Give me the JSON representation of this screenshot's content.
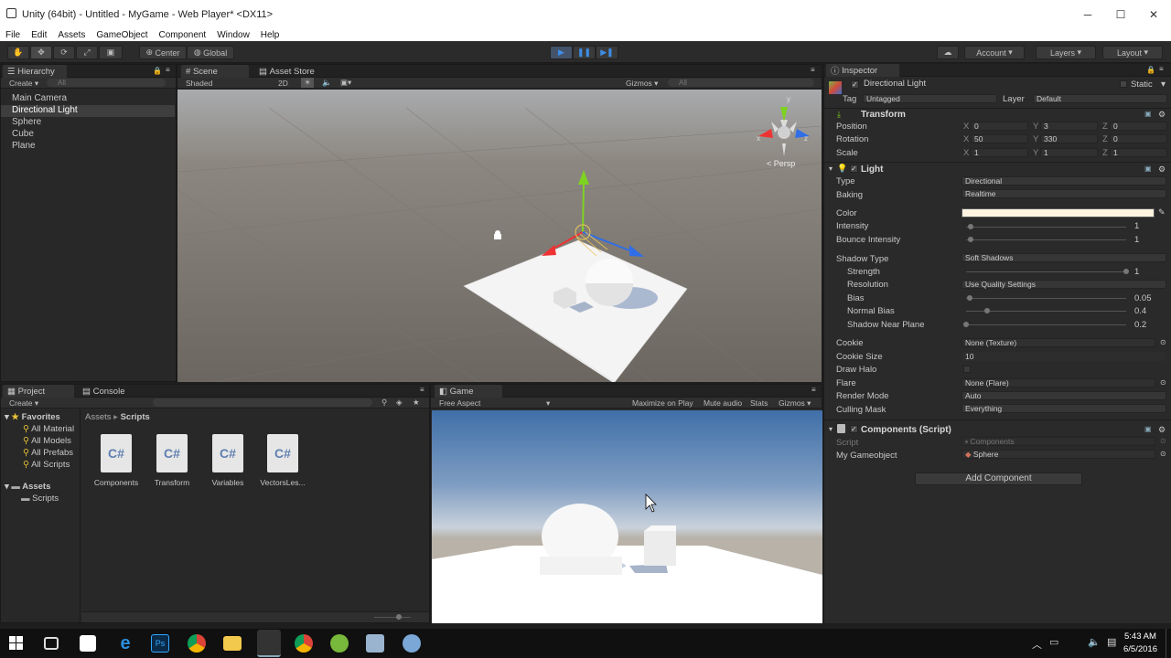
{
  "window": {
    "title": "Unity (64bit) - Untitled - MyGame - Web Player* <DX11>"
  },
  "menu": [
    "File",
    "Edit",
    "Assets",
    "GameObject",
    "Component",
    "Window",
    "Help"
  ],
  "toolbar": {
    "pivot": "Center",
    "space": "Global",
    "account": "Account",
    "layers": "Layers",
    "layout": "Layout"
  },
  "hierarchy": {
    "tab": "Hierarchy",
    "create": "Create",
    "search_placeholder": "All",
    "items": [
      "Main Camera",
      "Directional Light",
      "Sphere",
      "Cube",
      "Plane"
    ],
    "selected": "Directional Light"
  },
  "scene": {
    "tab": "Scene",
    "tab2": "Asset Store",
    "shading": "Shaded",
    "mode2d": "2D",
    "gizmos": "Gizmos",
    "search_placeholder": "All",
    "persp": "Persp"
  },
  "project": {
    "tab": "Project",
    "tab2": "Console",
    "create": "Create",
    "favorites_label": "Favorites",
    "favorites": [
      "All Material",
      "All Models",
      "All Prefabs",
      "All Scripts"
    ],
    "assets_label": "Assets",
    "asset_folders": [
      "Scripts"
    ],
    "breadcrumb": [
      "Assets",
      "Scripts"
    ],
    "files": [
      "Components",
      "Transform",
      "Variables",
      "VectorsLes..."
    ],
    "file_icon_text": "C#"
  },
  "game": {
    "tab": "Game",
    "aspect": "Free Aspect",
    "maximize": "Maximize on Play",
    "mute": "Mute audio",
    "stats": "Stats",
    "gizmos": "Gizmos"
  },
  "inspector": {
    "tab": "Inspector",
    "object_name": "Directional Light",
    "static_label": "Static",
    "tag_label": "Tag",
    "tag": "Untagged",
    "layer_label": "Layer",
    "layer": "Default",
    "transform": {
      "title": "Transform",
      "position_label": "Position",
      "rotation_label": "Rotation",
      "scale_label": "Scale",
      "position": {
        "x": "0",
        "y": "3",
        "z": "0"
      },
      "rotation": {
        "x": "50",
        "y": "330",
        "z": "0"
      },
      "scale": {
        "x": "1",
        "y": "1",
        "z": "1"
      }
    },
    "light": {
      "title": "Light",
      "type_label": "Type",
      "type": "Directional",
      "baking_label": "Baking",
      "baking": "Realtime",
      "color_label": "Color",
      "color": "#fdf3e0",
      "intensity_label": "Intensity",
      "intensity": "1",
      "intensity_fraction": 0.03,
      "bounce_label": "Bounce Intensity",
      "bounce": "1",
      "bounce_fraction": 0.03,
      "shadow_type_label": "Shadow Type",
      "shadow_type": "Soft Shadows",
      "strength_label": "Strength",
      "strength": "1",
      "strength_fraction": 1.0,
      "resolution_label": "Resolution",
      "resolution": "Use Quality Settings",
      "bias_label": "Bias",
      "bias": "0.05",
      "bias_fraction": 0.02,
      "normal_bias_label": "Normal Bias",
      "normal_bias": "0.4",
      "normal_bias_fraction": 0.13,
      "near_plane_label": "Shadow Near Plane",
      "near_plane": "0.2",
      "near_plane_fraction": 0.0,
      "cookie_label": "Cookie",
      "cookie": "None (Texture)",
      "cookie_size_label": "Cookie Size",
      "cookie_size": "10",
      "draw_halo_label": "Draw Halo",
      "flare_label": "Flare",
      "flare": "None (Flare)",
      "render_mode_label": "Render Mode",
      "render_mode": "Auto",
      "culling_label": "Culling Mask",
      "culling": "Everything"
    },
    "script": {
      "title": "Components (Script)",
      "script_label": "Script",
      "script": "Components",
      "gameobject_label": "My Gameobject",
      "gameobject": "Sphere"
    },
    "add_component": "Add Component"
  },
  "taskbar": {
    "time": "5:43 AM",
    "date": "6/5/2016"
  },
  "colors": {
    "play_accent": "#3d8ee8",
    "selection": "#3e3e3e",
    "sky_top": "#3f6fa8",
    "ground": "#ffffff"
  }
}
